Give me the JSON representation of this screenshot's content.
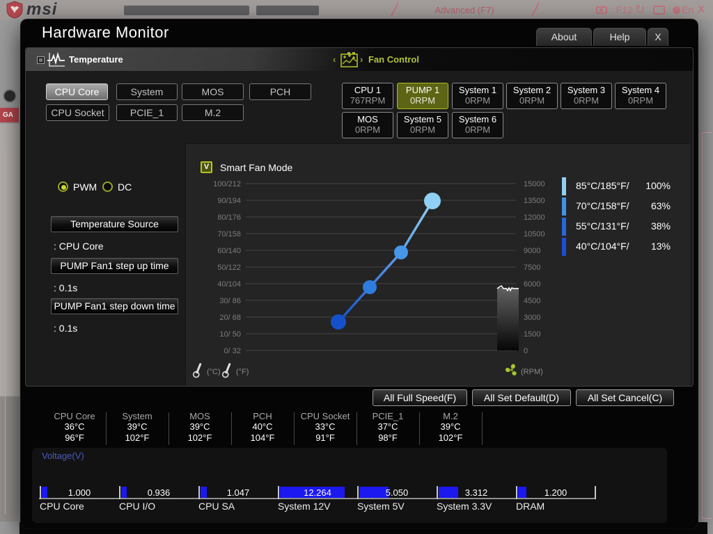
{
  "background": {
    "brand": "msi",
    "menu_label": "Advanced (F7)",
    "hotkey_label": ": F12",
    "lang_label": "En",
    "close_label": "X",
    "badge": "GA"
  },
  "window": {
    "title": "Hardware Monitor",
    "tabs": [
      "About",
      "Help",
      "X"
    ]
  },
  "temperature_section": {
    "label": "Temperature",
    "buttons": [
      {
        "label": "CPU Core",
        "selected": true
      },
      {
        "label": "System",
        "selected": false
      },
      {
        "label": "MOS",
        "selected": false
      },
      {
        "label": "PCH",
        "selected": false
      },
      {
        "label": "CPU Socket",
        "selected": false
      },
      {
        "label": "PCIE_1",
        "selected": false
      },
      {
        "label": "M.2",
        "selected": false
      }
    ]
  },
  "fan_section": {
    "label": "Fan Control",
    "fans": [
      {
        "name": "CPU 1",
        "rpm": "767RPM",
        "selected": false
      },
      {
        "name": "PUMP 1",
        "rpm": "0RPM",
        "selected": true
      },
      {
        "name": "System 1",
        "rpm": "0RPM",
        "selected": false
      },
      {
        "name": "System 2",
        "rpm": "0RPM",
        "selected": false
      },
      {
        "name": "System 3",
        "rpm": "0RPM",
        "selected": false
      },
      {
        "name": "System 4",
        "rpm": "0RPM",
        "selected": false
      },
      {
        "name": "MOS",
        "rpm": "0RPM",
        "selected": false
      },
      {
        "name": "System 5",
        "rpm": "0RPM",
        "selected": false
      },
      {
        "name": "System 6",
        "rpm": "0RPM",
        "selected": false
      }
    ]
  },
  "controls": {
    "modes": [
      {
        "label": "PWM",
        "selected": true
      },
      {
        "label": "DC",
        "selected": false
      }
    ],
    "fields": [
      {
        "title": "Temperature Source",
        "value": ": CPU Core"
      },
      {
        "title": "PUMP Fan1 step up time",
        "value": ": 0.1s"
      },
      {
        "title": "PUMP Fan1 step down time",
        "value": ": 0.1s"
      }
    ]
  },
  "chart_data": {
    "type": "line",
    "title": "Smart Fan Mode",
    "checkbox_checked": true,
    "checkbox_glyph": "V",
    "left_axis_ticks": [
      "100/212",
      "90/194",
      "80/176",
      "70/158",
      "60/140",
      "50/122",
      "40/104",
      "30/ 86",
      "20/ 68",
      "10/ 50",
      "0/ 32"
    ],
    "right_axis_ticks": [
      "15000",
      "13500",
      "12000",
      "10500",
      "9000",
      "7500",
      "6000",
      "4500",
      "3000",
      "1500",
      "0"
    ],
    "left_axis_range_c": [
      0,
      100
    ],
    "right_axis_range_rpm": [
      0,
      15000
    ],
    "x_unit_labels": [
      "(°C)",
      "(°F)"
    ],
    "y_unit_label": "(RPM)",
    "grid": true,
    "points": [
      {
        "temp_c": 40,
        "percent": 13,
        "color": "#1551cb",
        "r": 11
      },
      {
        "temp_c": 55,
        "percent": 38,
        "color": "#2e7cdf",
        "r": 10
      },
      {
        "temp_c": 70,
        "percent": 63,
        "color": "#4797e8",
        "r": 10
      },
      {
        "temp_c": 85,
        "percent": 100,
        "color": "#8fd0f4",
        "r": 12
      }
    ],
    "legend": [
      {
        "label": "85°C/185°F/",
        "value": "100%",
        "color": "#8fd0f4"
      },
      {
        "label": "70°C/158°F/",
        "value": "63%",
        "color": "#3f93e6"
      },
      {
        "label": "55°C/131°F/",
        "value": "38%",
        "color": "#2568db"
      },
      {
        "label": "40°C/104°F/",
        "value": "13%",
        "color": "#1b4ed2"
      }
    ]
  },
  "actions": [
    "All Full Speed(F)",
    "All Set Default(D)",
    "All Set Cancel(C)"
  ],
  "temperatures": [
    {
      "name": "CPU Core",
      "celsius": "36°C",
      "fahrenheit": "96°F"
    },
    {
      "name": "System",
      "celsius": "39°C",
      "fahrenheit": "102°F"
    },
    {
      "name": "MOS",
      "celsius": "39°C",
      "fahrenheit": "102°F"
    },
    {
      "name": "PCH",
      "celsius": "40°C",
      "fahrenheit": "104°F"
    },
    {
      "name": "CPU Socket",
      "celsius": "33°C",
      "fahrenheit": "91°F"
    },
    {
      "name": "PCIE_1",
      "celsius": "37°C",
      "fahrenheit": "98°F"
    },
    {
      "name": "M.2",
      "celsius": "39°C",
      "fahrenheit": "102°F"
    }
  ],
  "voltage": {
    "label": "Voltage(V)",
    "rails": [
      {
        "name": "CPU Core",
        "value": "1.000",
        "fill": 0.07
      },
      {
        "name": "CPU I/O",
        "value": "0.936",
        "fill": 0.07
      },
      {
        "name": "CPU SA",
        "value": "1.047",
        "fill": 0.08
      },
      {
        "name": "System 12V",
        "value": "12.264",
        "fill": 0.86
      },
      {
        "name": "System 5V",
        "value": "5.050",
        "fill": 0.39
      },
      {
        "name": "System 3.3V",
        "value": "3.312",
        "fill": 0.26
      },
      {
        "name": "DRAM",
        "value": "1.200",
        "fill": 0.11
      }
    ]
  }
}
